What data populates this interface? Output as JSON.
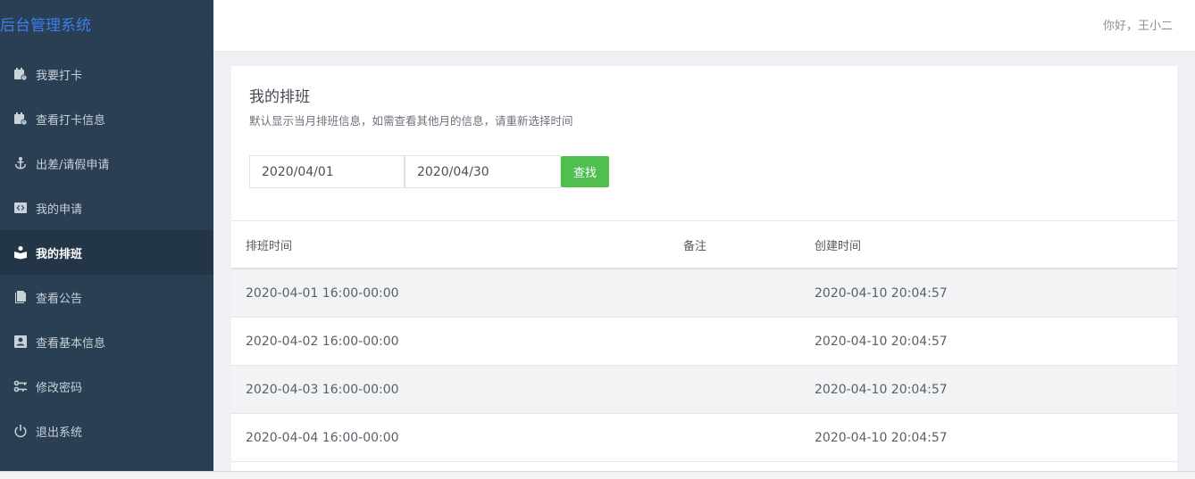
{
  "app": {
    "brand": "后台管理系统",
    "greeting": "你好，王小二"
  },
  "sidebar": {
    "items": [
      {
        "label": "我要打卡",
        "icon": "calendar-clock-icon",
        "active": false
      },
      {
        "label": "查看打卡信息",
        "icon": "calendar-clock-icon",
        "active": false
      },
      {
        "label": "出差/请假申请",
        "icon": "anchor-icon",
        "active": false
      },
      {
        "label": "我的申请",
        "icon": "code-square-icon",
        "active": false
      },
      {
        "label": "我的排班",
        "icon": "reader-icon",
        "active": true
      },
      {
        "label": "查看公告",
        "icon": "documents-icon",
        "active": false
      },
      {
        "label": "查看基本信息",
        "icon": "profile-card-icon",
        "active": false
      },
      {
        "label": "修改密码",
        "icon": "keys-icon",
        "active": false
      },
      {
        "label": "退出系统",
        "icon": "power-icon",
        "active": false
      }
    ]
  },
  "panel": {
    "title": "我的排班",
    "description": "默认显示当月排班信息，如需查看其他月的信息，请重新选择时间",
    "start_date": "2020/04/01",
    "end_date": "2020/04/30",
    "search_label": "查找"
  },
  "table": {
    "headers": [
      "排班时间",
      "备注",
      "创建时间"
    ],
    "rows": [
      {
        "time": "2020-04-01 16:00-00:00",
        "note": "",
        "created": "2020-04-10 20:04:57"
      },
      {
        "time": "2020-04-02 16:00-00:00",
        "note": "",
        "created": "2020-04-10 20:04:57"
      },
      {
        "time": "2020-04-03 16:00-00:00",
        "note": "",
        "created": "2020-04-10 20:04:57"
      },
      {
        "time": "2020-04-04 16:00-00:00",
        "note": "",
        "created": "2020-04-10 20:04:57"
      }
    ]
  },
  "colors": {
    "sidebar_bg": "#2a3f54",
    "brand": "#3c7ef0",
    "accent_green": "#4fbf4f"
  }
}
